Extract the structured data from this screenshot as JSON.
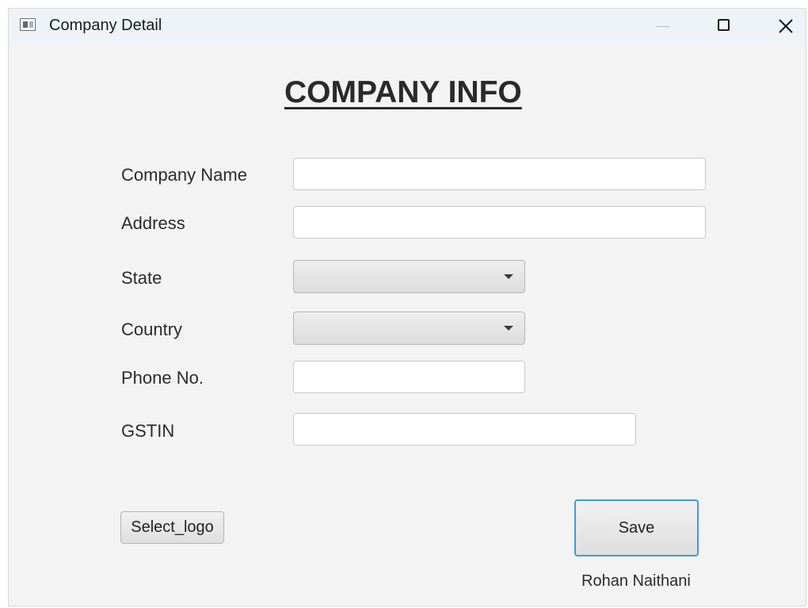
{
  "window": {
    "title": "Company Detail"
  },
  "form": {
    "heading": "COMPANY INFO",
    "company_name": {
      "label": "Company Name",
      "value": ""
    },
    "address": {
      "label": "Address",
      "value": ""
    },
    "state": {
      "label": "State",
      "selected": ""
    },
    "country": {
      "label": "Country",
      "selected": ""
    },
    "phone": {
      "label": "Phone No.",
      "value": ""
    },
    "gstin": {
      "label": "GSTIN",
      "value": ""
    }
  },
  "actions": {
    "select_logo_label": "Select_logo",
    "save_label": "Save"
  },
  "footer": {
    "author": "Rohan Naithani"
  },
  "colors": {
    "window_bg": "#f3f3f3",
    "titlebar_bg": "#eef3f8",
    "save_focus_border": "#3a9edb"
  }
}
